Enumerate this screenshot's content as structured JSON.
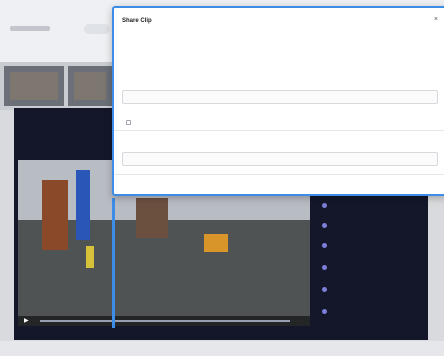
{
  "app": {
    "player_label": "",
    "thumbnails": [
      "",
      "",
      "",
      ""
    ]
  },
  "dialog": {
    "title": "Share Clip",
    "close_glyph": "×",
    "intro_line1": "",
    "intro_line2": "",
    "intro_link": "",
    "section_recipients": "",
    "recipients_placeholder": "",
    "message_placeholder": "",
    "checkbox_label": "",
    "section_message": "",
    "message_input": "",
    "footer_link": ""
  },
  "sidebar": {
    "items": [
      {
        "title": "",
        "subtitle": ""
      },
      {
        "title": "",
        "subtitle": ""
      },
      {
        "title": "",
        "subtitle": ""
      },
      {
        "title": "",
        "subtitle": ""
      },
      {
        "title": "",
        "subtitle": ""
      },
      {
        "title": "",
        "subtitle": ""
      }
    ]
  },
  "colors": {
    "accent": "#3d8de8",
    "panel_dark": "#14172a",
    "link": "#3b6fd8"
  },
  "icons": {
    "close": "close-icon",
    "play": "play-icon"
  }
}
